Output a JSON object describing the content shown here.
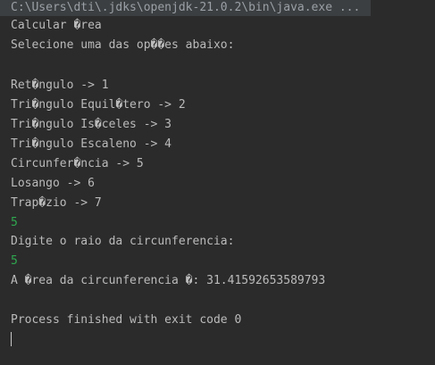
{
  "console": {
    "command": "C:\\Users\\dti\\.jdks\\openjdk-21.0.2\\bin\\java.exe ...",
    "output": {
      "title": "Calcular �rea",
      "prompt": "Selecione uma das op��es abaixo:",
      "options": [
        "Ret�ngulo -> 1",
        "Tri�ngulo Equil�tero -> 2",
        "Tri�ngulo Is�celes -> 3",
        "Tri�ngulo Escaleno -> 4",
        "Circunfer�ncia -> 5",
        "Losango -> 6",
        "Trap�zio -> 7"
      ],
      "user_choice": "5",
      "radius_prompt": "Digite o raio da circunferencia:",
      "radius_input": "5",
      "result": "A �rea da circunferencia �: 31.41592653589793",
      "exit_message": "Process finished with exit code 0"
    }
  }
}
